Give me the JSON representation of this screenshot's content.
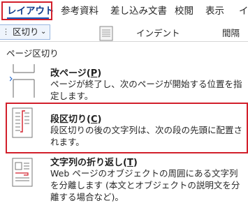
{
  "ribbon": {
    "tabs": [
      {
        "label": "レイアウト",
        "active": true
      },
      {
        "label": "参考資料",
        "active": false
      },
      {
        "label": "差し込み文書",
        "active": false
      },
      {
        "label": "校閲",
        "active": false
      },
      {
        "label": "表示",
        "active": false
      }
    ],
    "more_indicator": "イ"
  },
  "toolbar": {
    "breaks_button": {
      "label": "区切り",
      "chevron": "⌄",
      "dots": "⋮"
    },
    "indent_label": "インデント",
    "spacing_label": "間隔"
  },
  "menu": {
    "section_title": "ページ区切り",
    "items": [
      {
        "name": "改ページ",
        "key": "P",
        "description": "ページが終了し、次のページが開始する位置を指定します。",
        "icon": "page-break-icon"
      },
      {
        "name": "段区切り",
        "key": "C",
        "description": "段区切りの後の文字列は、次の段の先頭に配置されます。",
        "icon": "column-break-icon"
      },
      {
        "name": "文字列の折り返し",
        "key": "T",
        "description": "Web ページのオブジェクトの周囲にある文字列を分離します (本文とオブジェクトの説明文を分離する場合など)。",
        "icon": "text-wrapping-icon"
      }
    ]
  },
  "colors": {
    "highlight": "#d21f2b",
    "accent": "#1a5bbf",
    "active_tab_text": "#0f3c8c"
  }
}
